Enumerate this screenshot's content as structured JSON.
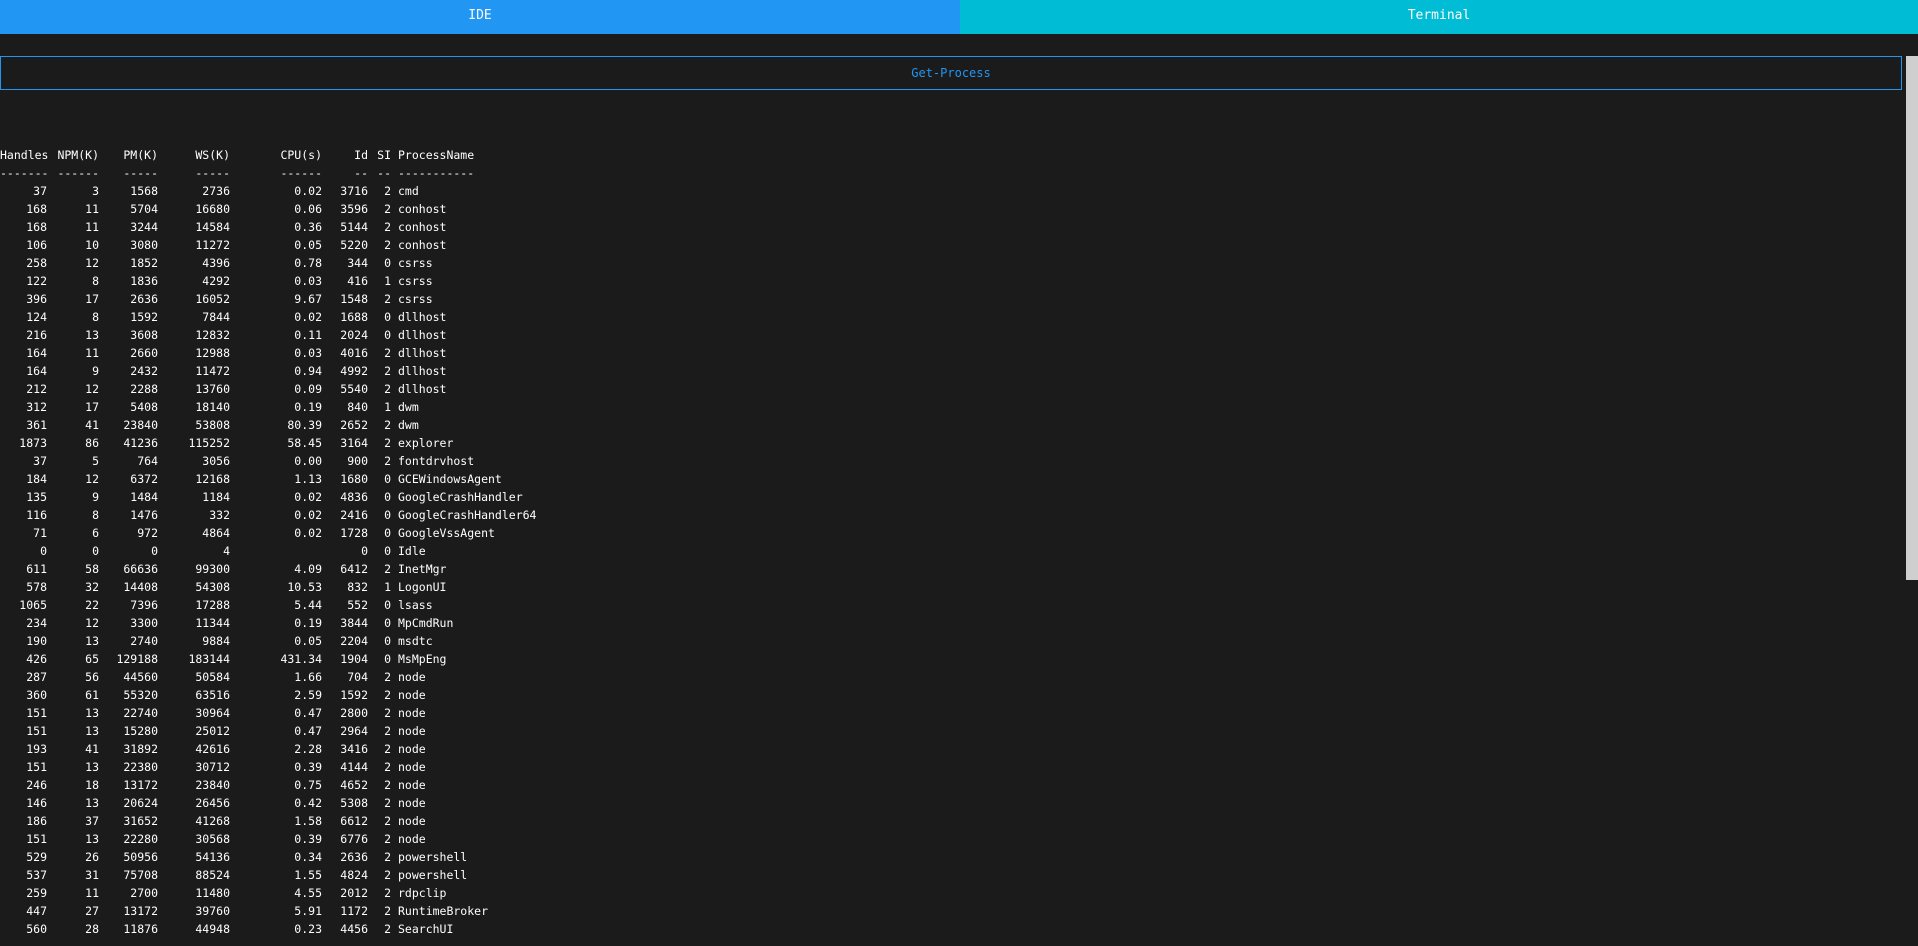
{
  "tabs": [
    {
      "label": "IDE",
      "color": "#2196f3"
    },
    {
      "label": "Terminal",
      "color": "#00bcd4"
    }
  ],
  "command": {
    "label": "Get-Process"
  },
  "table": {
    "headers": [
      "Handles",
      "NPM(K)",
      "PM(K)",
      "WS(K)",
      "CPU(s)",
      "Id",
      "SI",
      "ProcessName"
    ],
    "separators": [
      "-------",
      "------",
      "-----",
      "-----",
      "------",
      "--",
      "--",
      "-----------"
    ],
    "rows": [
      [
        "37",
        "3",
        "1568",
        "2736",
        "0.02",
        "3716",
        "2",
        "cmd"
      ],
      [
        "168",
        "11",
        "5704",
        "16680",
        "0.06",
        "3596",
        "2",
        "conhost"
      ],
      [
        "168",
        "11",
        "3244",
        "14584",
        "0.36",
        "5144",
        "2",
        "conhost"
      ],
      [
        "106",
        "10",
        "3080",
        "11272",
        "0.05",
        "5220",
        "2",
        "conhost"
      ],
      [
        "258",
        "12",
        "1852",
        "4396",
        "0.78",
        "344",
        "0",
        "csrss"
      ],
      [
        "122",
        "8",
        "1836",
        "4292",
        "0.03",
        "416",
        "1",
        "csrss"
      ],
      [
        "396",
        "17",
        "2636",
        "16052",
        "9.67",
        "1548",
        "2",
        "csrss"
      ],
      [
        "124",
        "8",
        "1592",
        "7844",
        "0.02",
        "1688",
        "0",
        "dllhost"
      ],
      [
        "216",
        "13",
        "3608",
        "12832",
        "0.11",
        "2024",
        "0",
        "dllhost"
      ],
      [
        "164",
        "11",
        "2660",
        "12988",
        "0.03",
        "4016",
        "2",
        "dllhost"
      ],
      [
        "164",
        "9",
        "2432",
        "11472",
        "0.94",
        "4992",
        "2",
        "dllhost"
      ],
      [
        "212",
        "12",
        "2288",
        "13760",
        "0.09",
        "5540",
        "2",
        "dllhost"
      ],
      [
        "312",
        "17",
        "5408",
        "18140",
        "0.19",
        "840",
        "1",
        "dwm"
      ],
      [
        "361",
        "41",
        "23840",
        "53808",
        "80.39",
        "2652",
        "2",
        "dwm"
      ],
      [
        "1873",
        "86",
        "41236",
        "115252",
        "58.45",
        "3164",
        "2",
        "explorer"
      ],
      [
        "37",
        "5",
        "764",
        "3056",
        "0.00",
        "900",
        "2",
        "fontdrvhost"
      ],
      [
        "184",
        "12",
        "6372",
        "12168",
        "1.13",
        "1680",
        "0",
        "GCEWindowsAgent"
      ],
      [
        "135",
        "9",
        "1484",
        "1184",
        "0.02",
        "4836",
        "0",
        "GoogleCrashHandler"
      ],
      [
        "116",
        "8",
        "1476",
        "332",
        "0.02",
        "2416",
        "0",
        "GoogleCrashHandler64"
      ],
      [
        "71",
        "6",
        "972",
        "4864",
        "0.02",
        "1728",
        "0",
        "GoogleVssAgent"
      ],
      [
        "0",
        "0",
        "0",
        "4",
        "",
        "0",
        "0",
        "Idle"
      ],
      [
        "611",
        "58",
        "66636",
        "99300",
        "4.09",
        "6412",
        "2",
        "InetMgr"
      ],
      [
        "578",
        "32",
        "14408",
        "54308",
        "10.53",
        "832",
        "1",
        "LogonUI"
      ],
      [
        "1065",
        "22",
        "7396",
        "17288",
        "5.44",
        "552",
        "0",
        "lsass"
      ],
      [
        "234",
        "12",
        "3300",
        "11344",
        "0.19",
        "3844",
        "0",
        "MpCmdRun"
      ],
      [
        "190",
        "13",
        "2740",
        "9884",
        "0.05",
        "2204",
        "0",
        "msdtc"
      ],
      [
        "426",
        "65",
        "129188",
        "183144",
        "431.34",
        "1904",
        "0",
        "MsMpEng"
      ],
      [
        "287",
        "56",
        "44560",
        "50584",
        "1.66",
        "704",
        "2",
        "node"
      ],
      [
        "360",
        "61",
        "55320",
        "63516",
        "2.59",
        "1592",
        "2",
        "node"
      ],
      [
        "151",
        "13",
        "22740",
        "30964",
        "0.47",
        "2800",
        "2",
        "node"
      ],
      [
        "151",
        "13",
        "15280",
        "25012",
        "0.47",
        "2964",
        "2",
        "node"
      ],
      [
        "193",
        "41",
        "31892",
        "42616",
        "2.28",
        "3416",
        "2",
        "node"
      ],
      [
        "151",
        "13",
        "22380",
        "30712",
        "0.39",
        "4144",
        "2",
        "node"
      ],
      [
        "246",
        "18",
        "13172",
        "23840",
        "0.75",
        "4652",
        "2",
        "node"
      ],
      [
        "146",
        "13",
        "20624",
        "26456",
        "0.42",
        "5308",
        "2",
        "node"
      ],
      [
        "186",
        "37",
        "31652",
        "41268",
        "1.58",
        "6612",
        "2",
        "node"
      ],
      [
        "151",
        "13",
        "22280",
        "30568",
        "0.39",
        "6776",
        "2",
        "node"
      ],
      [
        "529",
        "26",
        "50956",
        "54136",
        "0.34",
        "2636",
        "2",
        "powershell"
      ],
      [
        "537",
        "31",
        "75708",
        "88524",
        "1.55",
        "4824",
        "2",
        "powershell"
      ],
      [
        "259",
        "11",
        "2700",
        "11480",
        "4.55",
        "2012",
        "2",
        "rdpclip"
      ],
      [
        "447",
        "27",
        "13172",
        "39760",
        "5.91",
        "1172",
        "2",
        "RuntimeBroker"
      ],
      [
        "560",
        "28",
        "11876",
        "44948",
        "0.23",
        "4456",
        "2",
        "SearchUI"
      ]
    ]
  }
}
